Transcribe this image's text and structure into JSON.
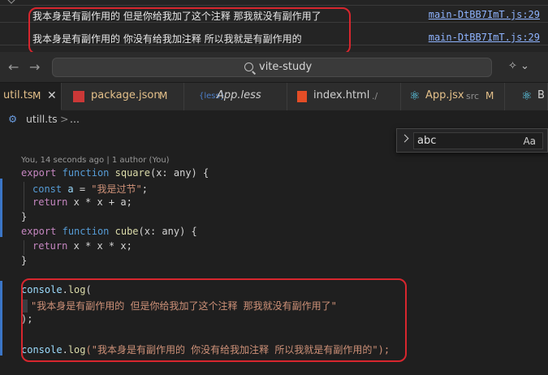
{
  "console": {
    "rows": [
      {
        "message": "我本身是有副作用的 但是你给我加了这个注释 那我就没有副作用了",
        "source": "main-DtBB7ImT.js:29"
      },
      {
        "message": "我本身是有副作用的 你没有给我加注释 所以我就是有副作用的",
        "source": "main-DtBB7ImT.js:29"
      }
    ],
    "colors": {
      "highlight_box": "#d7262e",
      "link": "#8fb4ff"
    }
  },
  "titlebar": {
    "back_icon": "arrow-left-icon",
    "forward_icon": "arrow-right-icon",
    "search_label": "vite-study",
    "search_icon": "search-icon",
    "copilot_icon": "copilot-icon"
  },
  "tabs": [
    {
      "label": "util.ts",
      "meta": "",
      "mark": "M",
      "icon": "typescript-icon",
      "active": true,
      "closable": true
    },
    {
      "label": "package.json",
      "meta": "",
      "mark": "M",
      "icon": "npm-icon",
      "active": false
    },
    {
      "label": "App.less",
      "meta": "",
      "mark": "",
      "icon": "less-icon",
      "active": false
    },
    {
      "label": "index.html",
      "meta": "./",
      "mark": "",
      "icon": "html5-icon",
      "active": false
    },
    {
      "label": "App.jsx",
      "meta": "src",
      "mark": "M",
      "icon": "react-icon",
      "active": false
    },
    {
      "label": "B",
      "meta": "",
      "mark": "",
      "icon": "react-icon",
      "active": false
    }
  ],
  "breadcrumb": {
    "file": "utill.ts",
    "sep": ">",
    "more": "..."
  },
  "find": {
    "value": "abc",
    "match_case_label": "Aa"
  },
  "editor": {
    "blame": "You, 14 seconds ago | 1 author (You)",
    "code": {
      "l1_kw": "export",
      "l1_kw2": "function",
      "l1_fn": "square",
      "l1_rest": "(x: any) {",
      "l2_kw": "const",
      "l2_var": "a",
      "l2_eq": " = ",
      "l2_str": "\"我是过节\"",
      "l2_end": ";",
      "l3_kw": "return",
      "l3_rest": " x * x + a;",
      "l4": "}",
      "l5_kw": "export",
      "l5_kw2": "function",
      "l5_fn": "cube",
      "l5_rest": "(x: any) {",
      "l6_kw": "return",
      "l6_rest": " x * x * x;",
      "l7": "}",
      "l8_obj": "console",
      "l8_dot": ".",
      "l8_fn": "log",
      "l8_paren": "(",
      "l9_str": "\"我本身是有副作用的 但是你给我加了这个注释 那我就没有副作用了\"",
      "l10": ");",
      "l11_obj": "console",
      "l11_dot": ".",
      "l11_fn": "log",
      "l11_str": "(\"我本身是有副作用的 你没有给我加注释 所以我就是有副作用的\");"
    }
  }
}
